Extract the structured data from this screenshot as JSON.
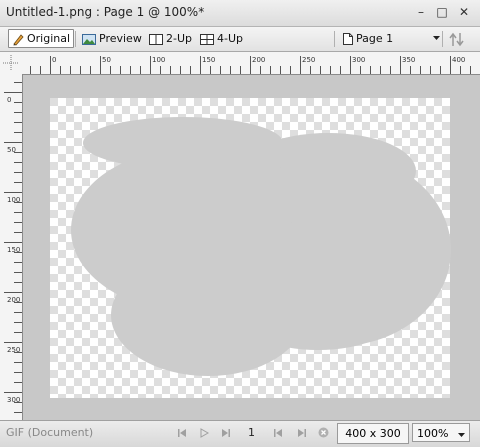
{
  "window": {
    "title": "Untitled-1.png : Page 1 @ 100%*",
    "minimize_glyph": "–",
    "restore_glyph": "□",
    "close_glyph": "✕"
  },
  "toolbar": {
    "original_label": "Original",
    "preview_label": "Preview",
    "twoup_label": "2-Up",
    "fourup_label": "4-Up",
    "page_label": "Page 1"
  },
  "rulers": {
    "h_ticks": [
      "0",
      "50",
      "100",
      "150",
      "200",
      "250",
      "300",
      "350",
      "400"
    ],
    "v_ticks": [
      "0",
      "50",
      "100",
      "150",
      "200",
      "250",
      "300"
    ]
  },
  "status": {
    "format_label": "GIF (Document)",
    "frame_number": "1",
    "dimensions": "400 x 300",
    "zoom": "100%"
  },
  "icons": {
    "pencil": "pencil-icon",
    "preview": "preview-icon",
    "twoup": "two-up-icon",
    "fourup": "four-up-icon",
    "page": "page-icon",
    "dropdown": "chevron-down-icon",
    "export": "export-icon"
  }
}
